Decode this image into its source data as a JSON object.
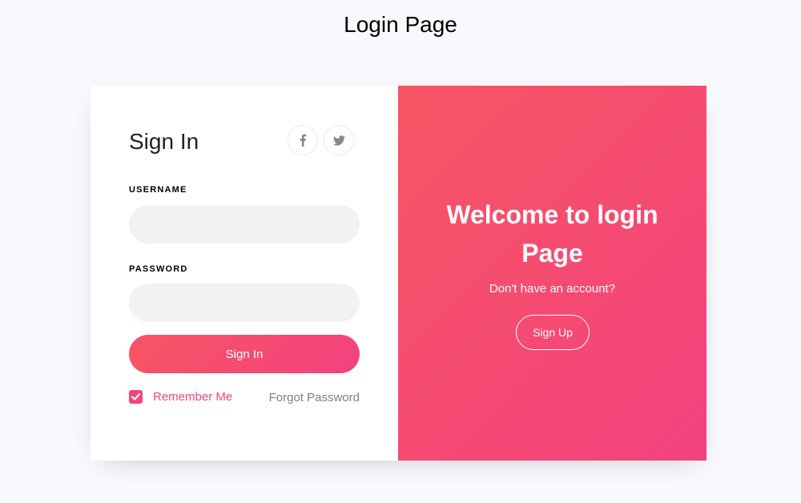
{
  "page": {
    "title": "Login Page"
  },
  "signin": {
    "heading": "Sign In",
    "social": [
      {
        "name": "facebook",
        "icon": "facebook-icon"
      },
      {
        "name": "twitter",
        "icon": "twitter-icon"
      }
    ],
    "username_label": "USERNAME",
    "username_value": "",
    "password_label": "PASSWORD",
    "password_value": "",
    "submit_label": "Sign In",
    "remember_label": "Remember Me",
    "remember_checked": true,
    "forgot_label": "Forgot Password"
  },
  "welcome": {
    "line1": "Welcome to login",
    "line2": "Page",
    "subtitle": "Don't have an account?",
    "signup_label": "Sign Up"
  },
  "colors": {
    "accent_start": "#f85563",
    "accent_end": "#f2427f",
    "background": "#f8f9fd"
  }
}
